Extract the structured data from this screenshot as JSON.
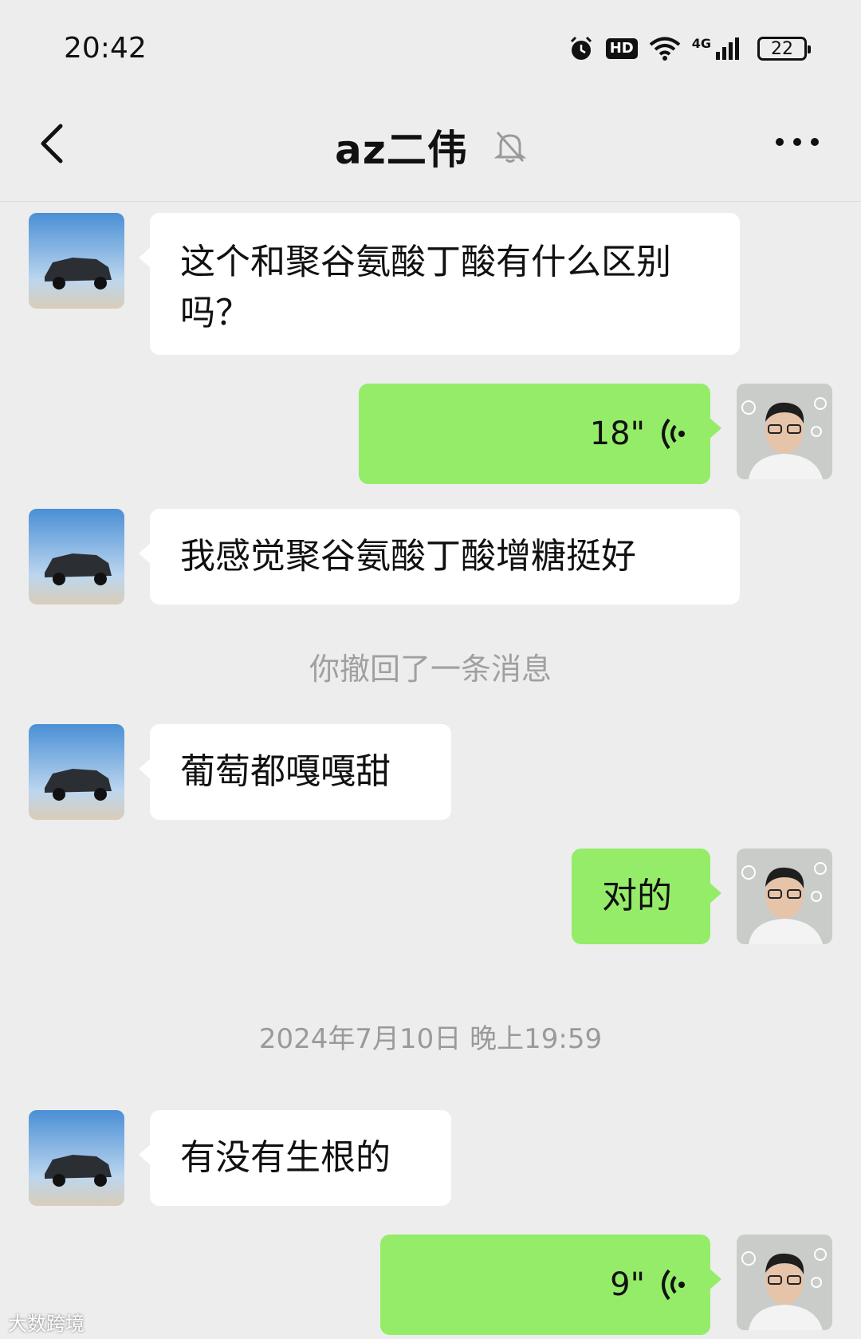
{
  "status_bar": {
    "time": "20:42",
    "hd": "HD",
    "network": "4G",
    "battery": "22"
  },
  "nav": {
    "title": "az二伟"
  },
  "messages": [
    {
      "side": "left",
      "type": "text",
      "text": "这个和聚谷氨酸丁酸有什么区别吗？"
    },
    {
      "side": "right",
      "type": "voice",
      "duration": "18\""
    },
    {
      "side": "left",
      "type": "text",
      "text": "我感觉聚谷氨酸丁酸增糖挺好"
    },
    {
      "side": "system",
      "text": "你撤回了一条消息"
    },
    {
      "side": "left",
      "type": "text",
      "text": "葡萄都嘎嘎甜"
    },
    {
      "side": "right",
      "type": "text",
      "text": "对的"
    },
    {
      "side": "timestamp",
      "text": "2024年7月10日 晚上19:59"
    },
    {
      "side": "left",
      "type": "text",
      "text": "有没有生根的"
    },
    {
      "side": "right",
      "type": "voice",
      "duration": "9\""
    }
  ],
  "watermark": "大数跨境",
  "colors": {
    "background": "#ededed",
    "sent_bubble": "#95ec69",
    "received_bubble": "#ffffff"
  }
}
